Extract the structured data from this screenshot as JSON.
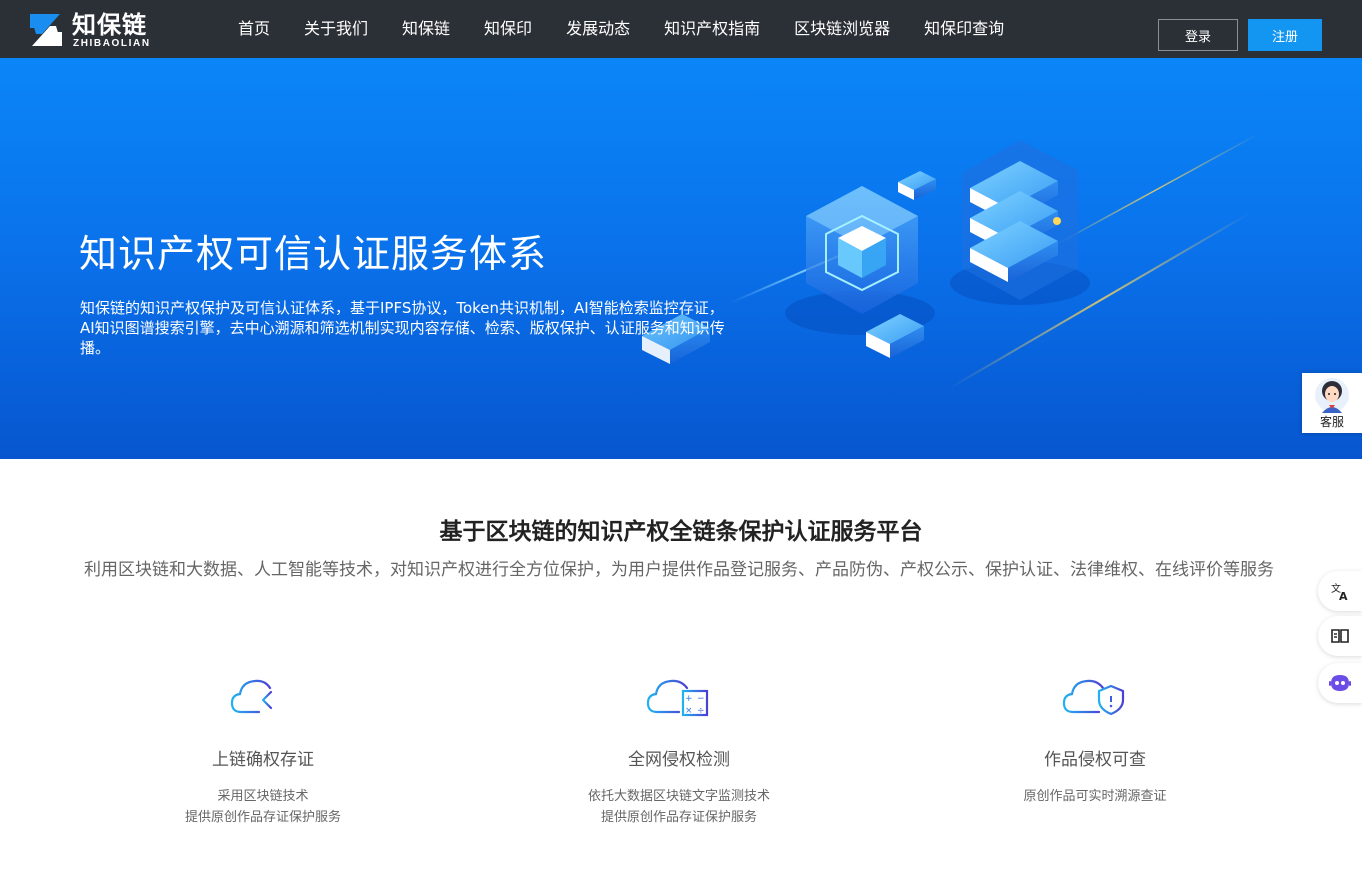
{
  "header": {
    "logo_name": "知保链",
    "logo_sub": "ZHIBAOLIAN",
    "nav": [
      "首页",
      "关于我们",
      "知保链",
      "知保印",
      "发展动态",
      "知识产权指南",
      "区块链浏览器",
      "知保印查询"
    ],
    "login_label": "登录",
    "register_label": "注册"
  },
  "hero": {
    "title": "知识产权可信认证服务体系",
    "description": "知保链的知识产权保护及可信认证体系，基于IPFS协议，Token共识机制，AI智能检索监控存证，AI知识图谱搜索引擎，去中心溯源和筛选机制实现内容存储、检索、版权保护、认证服务和知识传播。"
  },
  "side": {
    "service_label": "客服",
    "buttons": [
      "translate-icon",
      "reader-icon",
      "assistant-icon"
    ]
  },
  "intro": {
    "title": "基于区块链的知识产权全链条保护认证服务平台",
    "description": "利用区块链和大数据、人工智能等技术，对知识产权进行全方位保护，为用户提供作品登记服务、产品防伪、产权公示、保护认证、法律维权、在线评价等服务"
  },
  "features": [
    {
      "icon": "cloud-upload-icon",
      "title": "上链确权存证",
      "lines": [
        "采用区块链技术",
        "提供原创作品存证保护服务"
      ]
    },
    {
      "icon": "cloud-calculator-icon",
      "title": "全网侵权检测",
      "lines": [
        "依托大数据区块链文字监测技术",
        "提供原创作品存证保护服务"
      ]
    },
    {
      "icon": "cloud-shield-icon",
      "title": "作品侵权可查",
      "lines": [
        "原创作品可实时溯源查证"
      ]
    }
  ],
  "colors": {
    "header_bg": "#2b2f36",
    "accent": "#1296f2",
    "hero_top": "#0a86f8",
    "hero_bottom": "#0756cf",
    "icon_gradient_start": "#21b3f0",
    "icon_gradient_end": "#4b3fd6"
  }
}
